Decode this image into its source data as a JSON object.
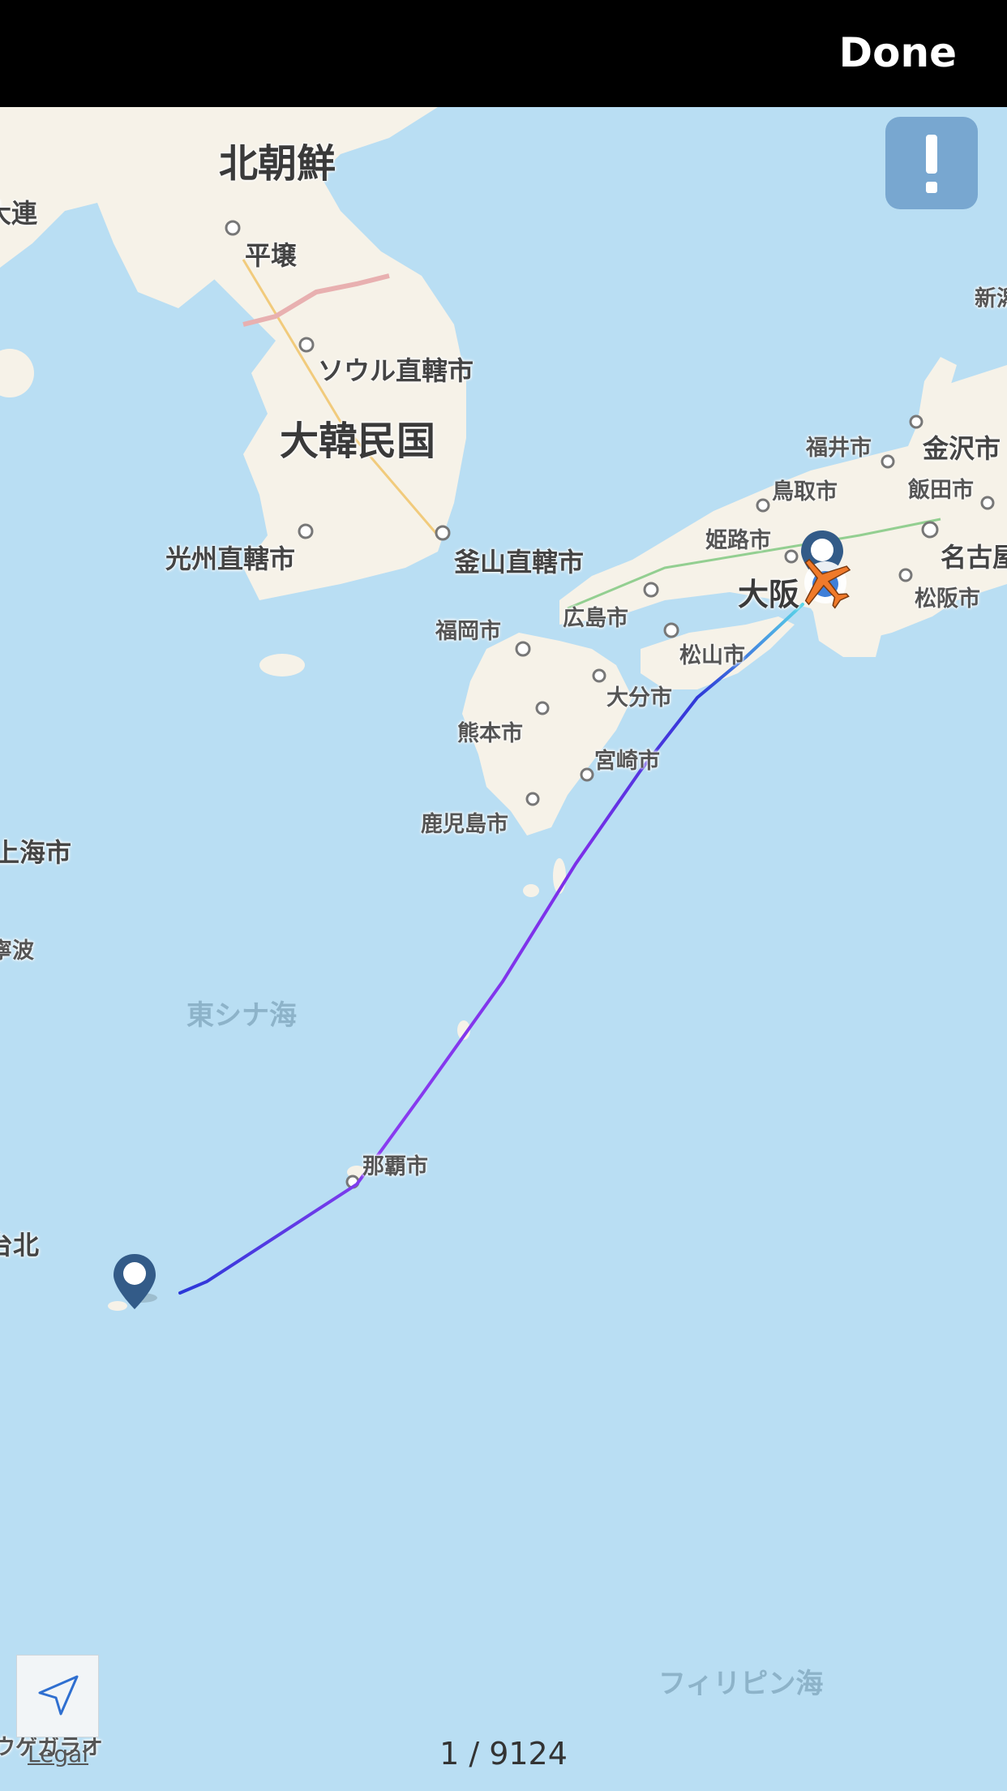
{
  "header": {
    "done_label": "Done"
  },
  "map": {
    "labels": {
      "north_korea": "北朝鮮",
      "dalian": "大連",
      "pyongyang": "平壌",
      "seoul": "ソウル直轄市",
      "south_korea": "大韓民国",
      "gwangju": "光州直轄市",
      "busan": "釜山直轄市",
      "fukuoka": "福岡市",
      "hiroshima": "広島市",
      "himeji": "姫路市",
      "tottori": "鳥取市",
      "fukui": "福井市",
      "kanazawa": "金沢市",
      "iida": "飯田市",
      "nagoya": "名古屋",
      "matsusaka": "松阪市",
      "osaka": "大阪",
      "matsuyama": "松山市",
      "oita": "大分市",
      "kumamoto": "熊本市",
      "miyazaki": "宮崎市",
      "kagoshima": "鹿児島市",
      "shanghai": "上海市",
      "ningbo": "寧波",
      "naha": "那覇市",
      "taipei": "台北",
      "niigata": "新潟",
      "kaohsiung": "ウゲガラオ"
    },
    "seas": {
      "east_china_sea": "東シナ海",
      "philippine_sea": "フィリピン海"
    },
    "colors": {
      "land": "#f6f2e8",
      "water": "#b9def3",
      "route_start": "#5ad7e8",
      "route_mid": "#2e3ad8",
      "route_end": "#8a3cf0",
      "plane": "#f07a2a"
    }
  },
  "footer": {
    "legal_label": "Legal",
    "counter": "1 / 9124"
  }
}
